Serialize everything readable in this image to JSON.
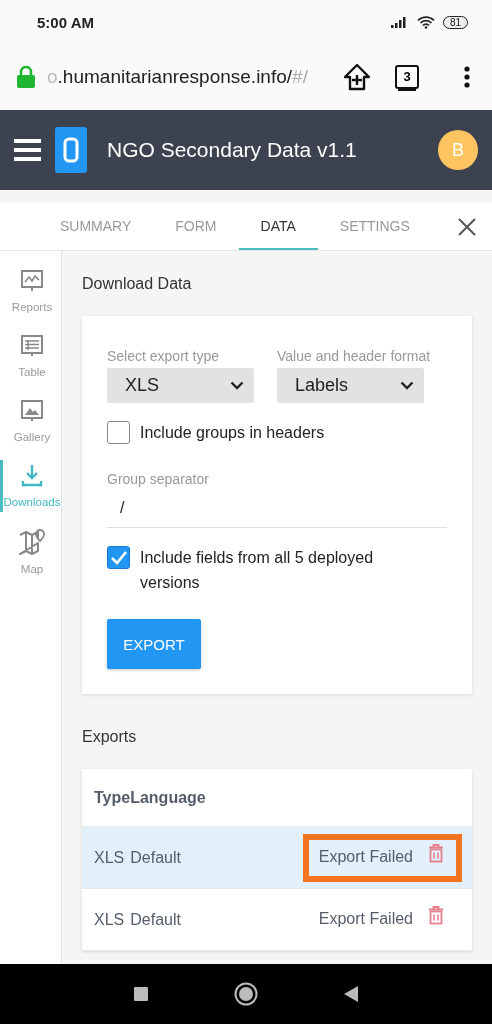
{
  "status_bar": {
    "time": "5:00 AM",
    "battery": "81"
  },
  "browser": {
    "url_start": "o",
    "url": ".humanitarianresponse.info/",
    "url_fragment": "#/",
    "tab_count": "3"
  },
  "app_header": {
    "title": "NGO Secondary Data v1.1",
    "avatar": "B"
  },
  "tabs": [
    {
      "label": "SUMMARY",
      "selected": false
    },
    {
      "label": "FORM",
      "selected": false
    },
    {
      "label": "DATA",
      "selected": true
    },
    {
      "label": "SETTINGS",
      "selected": false
    }
  ],
  "sidebar": {
    "items": [
      {
        "kind": "reports",
        "label": "Reports",
        "selected": false
      },
      {
        "kind": "table",
        "label": "Table",
        "selected": false
      },
      {
        "kind": "gallery",
        "label": "Gallery",
        "selected": false
      },
      {
        "kind": "downloads",
        "label": "Downloads",
        "selected": true
      },
      {
        "kind": "map",
        "label": "Map",
        "selected": false
      }
    ]
  },
  "download": {
    "title": "Download Data",
    "export_type": {
      "label": "Select export type",
      "value": "XLS"
    },
    "format": {
      "label": "Value and header format",
      "value": "Labels"
    },
    "include_groups": {
      "label": "Include groups in headers",
      "checked": false
    },
    "separator": {
      "label": "Group separator",
      "value": "/"
    },
    "include_versions": {
      "label": "Include fields from all 5 deployed versions",
      "checked": true
    },
    "export_button": "EXPORT"
  },
  "exports": {
    "title": "Exports",
    "columns": [
      "Type",
      "Language"
    ],
    "rows": [
      {
        "type": "XLS",
        "language": "Default",
        "status": "Export Failed",
        "selected": true,
        "highlighted": true
      },
      {
        "type": "XLS",
        "language": "Default",
        "status": "Export Failed",
        "selected": false,
        "highlighted": false
      }
    ]
  }
}
